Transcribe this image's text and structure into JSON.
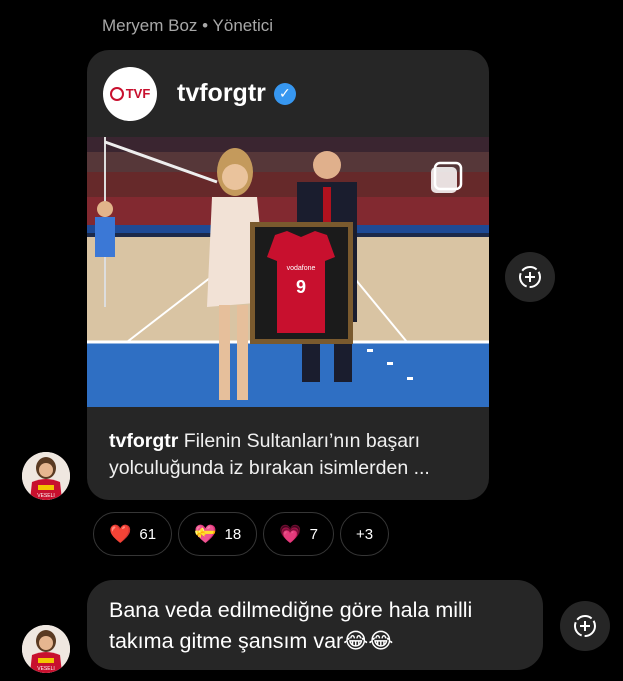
{
  "sender": {
    "name": "Meryem Boz",
    "separator": "•",
    "role": "Yönetici"
  },
  "shared_post": {
    "account": "tvforgtr",
    "logo_text": "TVF",
    "verified": true,
    "image": {
      "jersey_brand": "vodafone",
      "jersey_number": "9"
    },
    "caption_handle": "tvforgtr",
    "caption_text": "Filenin Sultanları’nın başarı yolculuğunda iz bırakan isimlerden ..."
  },
  "reactions": [
    {
      "emoji": "heart-icon",
      "glyph": "❤️",
      "count": "61"
    },
    {
      "emoji": "heart-with-ribbon-icon",
      "glyph": "💝",
      "count": "18"
    },
    {
      "emoji": "pink-heart-icon",
      "glyph": "💗",
      "count": "7"
    },
    {
      "emoji": "more-reactions",
      "glyph": "",
      "count": "+3"
    }
  ],
  "message": {
    "text": "Bana veda edilmediğne göre hala milli takıma gitme şansım var😂😂"
  },
  "avatar_jersey_text": "VESELI",
  "colors": {
    "background": "#000000",
    "bubble": "#262626",
    "accent_blue": "#3797f0",
    "jersey_red": "#c8102e"
  }
}
